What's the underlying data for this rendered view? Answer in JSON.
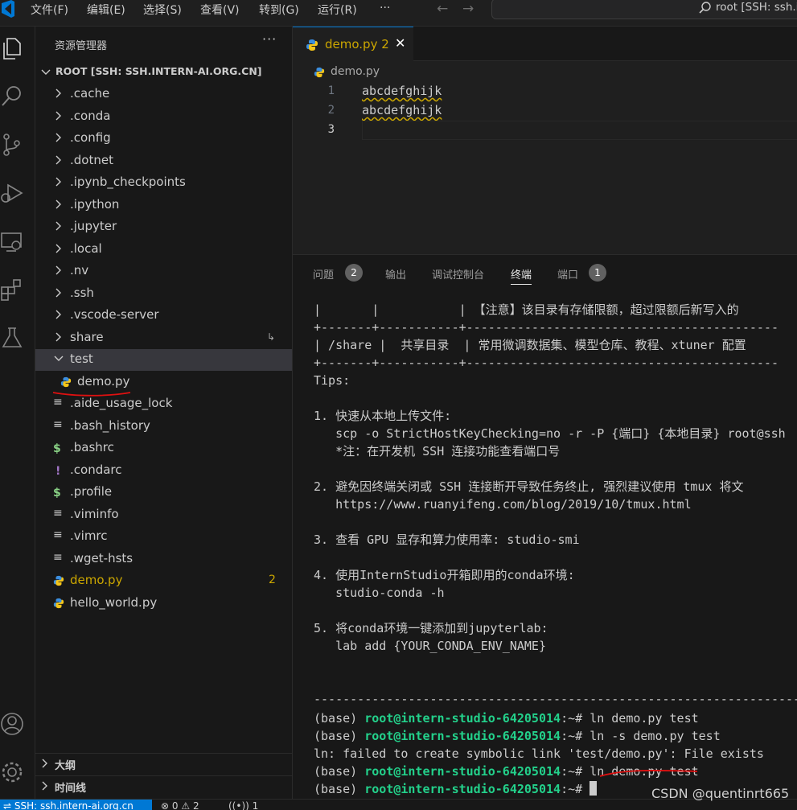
{
  "menu": [
    "文件(F)",
    "编辑(E)",
    "选择(S)",
    "查看(V)",
    "转到(G)",
    "运行(R)",
    "···"
  ],
  "window_title": "root [SSH: ssh.i",
  "explorer": {
    "title": "资源管理器",
    "more": "···",
    "root_label": "ROOT [SSH: SSH.INTERN-AI.ORG.CN]",
    "items": [
      {
        "label": ".cache"
      },
      {
        "label": ".conda"
      },
      {
        "label": ".config"
      },
      {
        "label": ".dotnet"
      },
      {
        "label": ".ipynb_checkpoints"
      },
      {
        "label": ".ipython"
      },
      {
        "label": ".jupyter"
      },
      {
        "label": ".local"
      },
      {
        "label": ".nv"
      },
      {
        "label": ".ssh"
      },
      {
        "label": ".vscode-server"
      },
      {
        "label": "share"
      },
      {
        "label": "test"
      },
      {
        "label": "demo.py"
      },
      {
        "label": ".aide_usage_lock"
      },
      {
        "label": ".bash_history"
      },
      {
        "label": ".bashrc"
      },
      {
        "label": ".condarc"
      },
      {
        "label": ".profile"
      },
      {
        "label": ".viminfo"
      },
      {
        "label": ".vimrc"
      },
      {
        "label": ".wget-hsts"
      },
      {
        "label": "demo.py",
        "badge": "2"
      },
      {
        "label": "hello_world.py"
      }
    ],
    "outline": "大纲",
    "timeline": "时间线"
  },
  "editor": {
    "tab_label": "demo.py 2",
    "breadcrumb": "demo.py",
    "lines": [
      {
        "num": "1",
        "text": "abcdefghijk"
      },
      {
        "num": "2",
        "text": "abcdefghijk"
      },
      {
        "num": "3",
        "text": ""
      }
    ]
  },
  "panel": {
    "tabs": {
      "problems": "问题",
      "problems_count": "2",
      "output": "输出",
      "debug": "调试控制台",
      "terminal": "终端",
      "ports": "端口",
      "ports_count": "1"
    },
    "terminal_lines": [
      "|       |           | 【注意】该目录有存储限额，超过限额后新写入的",
      "+-------+-----------+-------------------------------------------",
      "| /share |  共享目录  | 常用微调数据集、模型仓库、教程、xtuner 配置",
      "+-------+-----------+-------------------------------------------",
      "Tips:",
      "",
      "1. 快速从本地上传文件:",
      "   scp -o StrictHostKeyChecking=no -r -P {端口} {本地目录} root@ssh",
      "   *注：在开发机 SSH 连接功能查看端口号",
      "",
      "2. 避免因终端关闭或 SSH 连接断开导致任务终止, 强烈建议使用 tmux 将文",
      "   https://www.ruanyifeng.com/blog/2019/10/tmux.html",
      "",
      "3. 查看 GPU 显存和算力使用率: studio-smi",
      "",
      "4. 使用InternStudio开箱即用的conda环境:",
      "   studio-conda -h",
      "",
      "5. 将conda环境一键添加到jupyterlab:",
      "   lab add {YOUR_CONDA_ENV_NAME}",
      "",
      "",
      "-------------------------------------------------------------------"
    ],
    "prompt_user": "root@intern-studio-64205014",
    "prompt_prefix": "(base) ",
    "prompt_suffix": ":~# ",
    "commands": [
      {
        "cmd": "ln demo.py test",
        "status": "ok"
      },
      {
        "cmd": "ln -s demo.py test",
        "status": "error"
      },
      {
        "output": "ln: failed to create symbolic link 'test/demo.py': File exists"
      },
      {
        "cmd": "ln demo.py test",
        "status": "ok"
      },
      {
        "cmd": "",
        "status": "pending"
      }
    ]
  },
  "statusbar": {
    "remote": "SSH: ssh.intern-ai.org.cn",
    "errors": "0",
    "warnings": "2",
    "ports": "1"
  },
  "watermark": "CSDN @quentinrt665",
  "colors": {
    "accent": "#0078d4",
    "warning": "#cca700",
    "terminal_green": "#23d18b",
    "error": "#f14c4c",
    "ok_dot": "#3794ff"
  }
}
